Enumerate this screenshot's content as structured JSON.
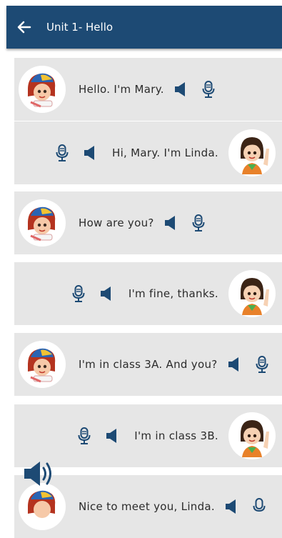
{
  "header": {
    "title": "Unit 1- Hello"
  },
  "icons": {
    "back": "arrow-left-icon",
    "speaker": "speaker-icon",
    "mic": "microphone-icon",
    "audio_fab": "volume-icon"
  },
  "colors": {
    "appbar": "#1d4a74",
    "icon": "#1d4a74",
    "row_bg": "#e6e6e6"
  },
  "dialogue": [
    {
      "speaker": "Mary",
      "side": "left",
      "text": "Hello. I'm Mary."
    },
    {
      "speaker": "Linda",
      "side": "right",
      "text": "Hi, Mary. I'm Linda."
    },
    {
      "speaker": "Mary",
      "side": "left",
      "text": "How are you?"
    },
    {
      "speaker": "Linda",
      "side": "right",
      "text": "I'm fine, thanks."
    },
    {
      "speaker": "Mary",
      "side": "left",
      "text": "I'm in class 3A. And you?"
    },
    {
      "speaker": "Linda",
      "side": "right",
      "text": "I'm in class 3B."
    },
    {
      "speaker": "Mary",
      "side": "left",
      "text": "Nice to meet you, Linda."
    }
  ]
}
